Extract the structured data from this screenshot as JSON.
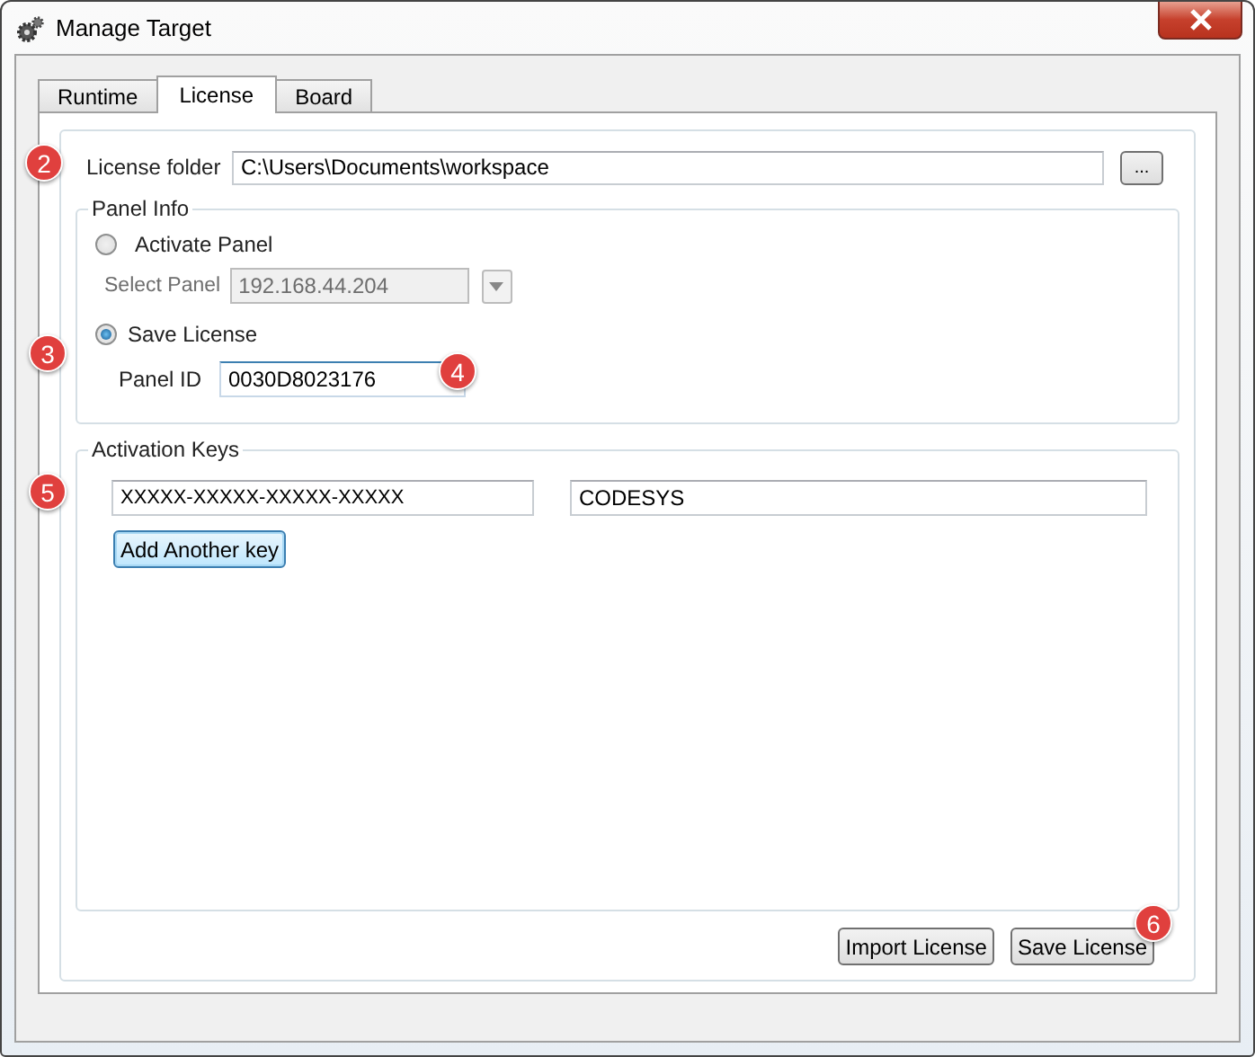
{
  "window": {
    "title": "Manage Target"
  },
  "tabs": [
    {
      "label": "Runtime",
      "selected": false
    },
    {
      "label": "License",
      "selected": true
    },
    {
      "label": "Board",
      "selected": false
    }
  ],
  "license_folder": {
    "label": "License folder",
    "value": "C:\\Users\\Documents\\workspace",
    "browse_button": "..."
  },
  "panel_info": {
    "title": "Panel Info",
    "options": [
      {
        "label": "Activate Panel",
        "selected": false
      },
      {
        "label": "Save License",
        "selected": true
      }
    ],
    "select_panel": {
      "label": "Select Panel",
      "value": "192.168.44.204",
      "disabled": true
    },
    "panel_id": {
      "label": "Panel ID",
      "value": "0030D8023176"
    }
  },
  "activation_keys": {
    "title": "Activation Keys",
    "keys": [
      {
        "key": "XXXXX-XXXXX-XXXXX-XXXXX",
        "product": "CODESYS"
      }
    ],
    "add_button": "Add Another key"
  },
  "buttons": [
    "Import License",
    "Save License"
  ],
  "callouts": [
    "2",
    "3",
    "4",
    "5",
    "6"
  ]
}
